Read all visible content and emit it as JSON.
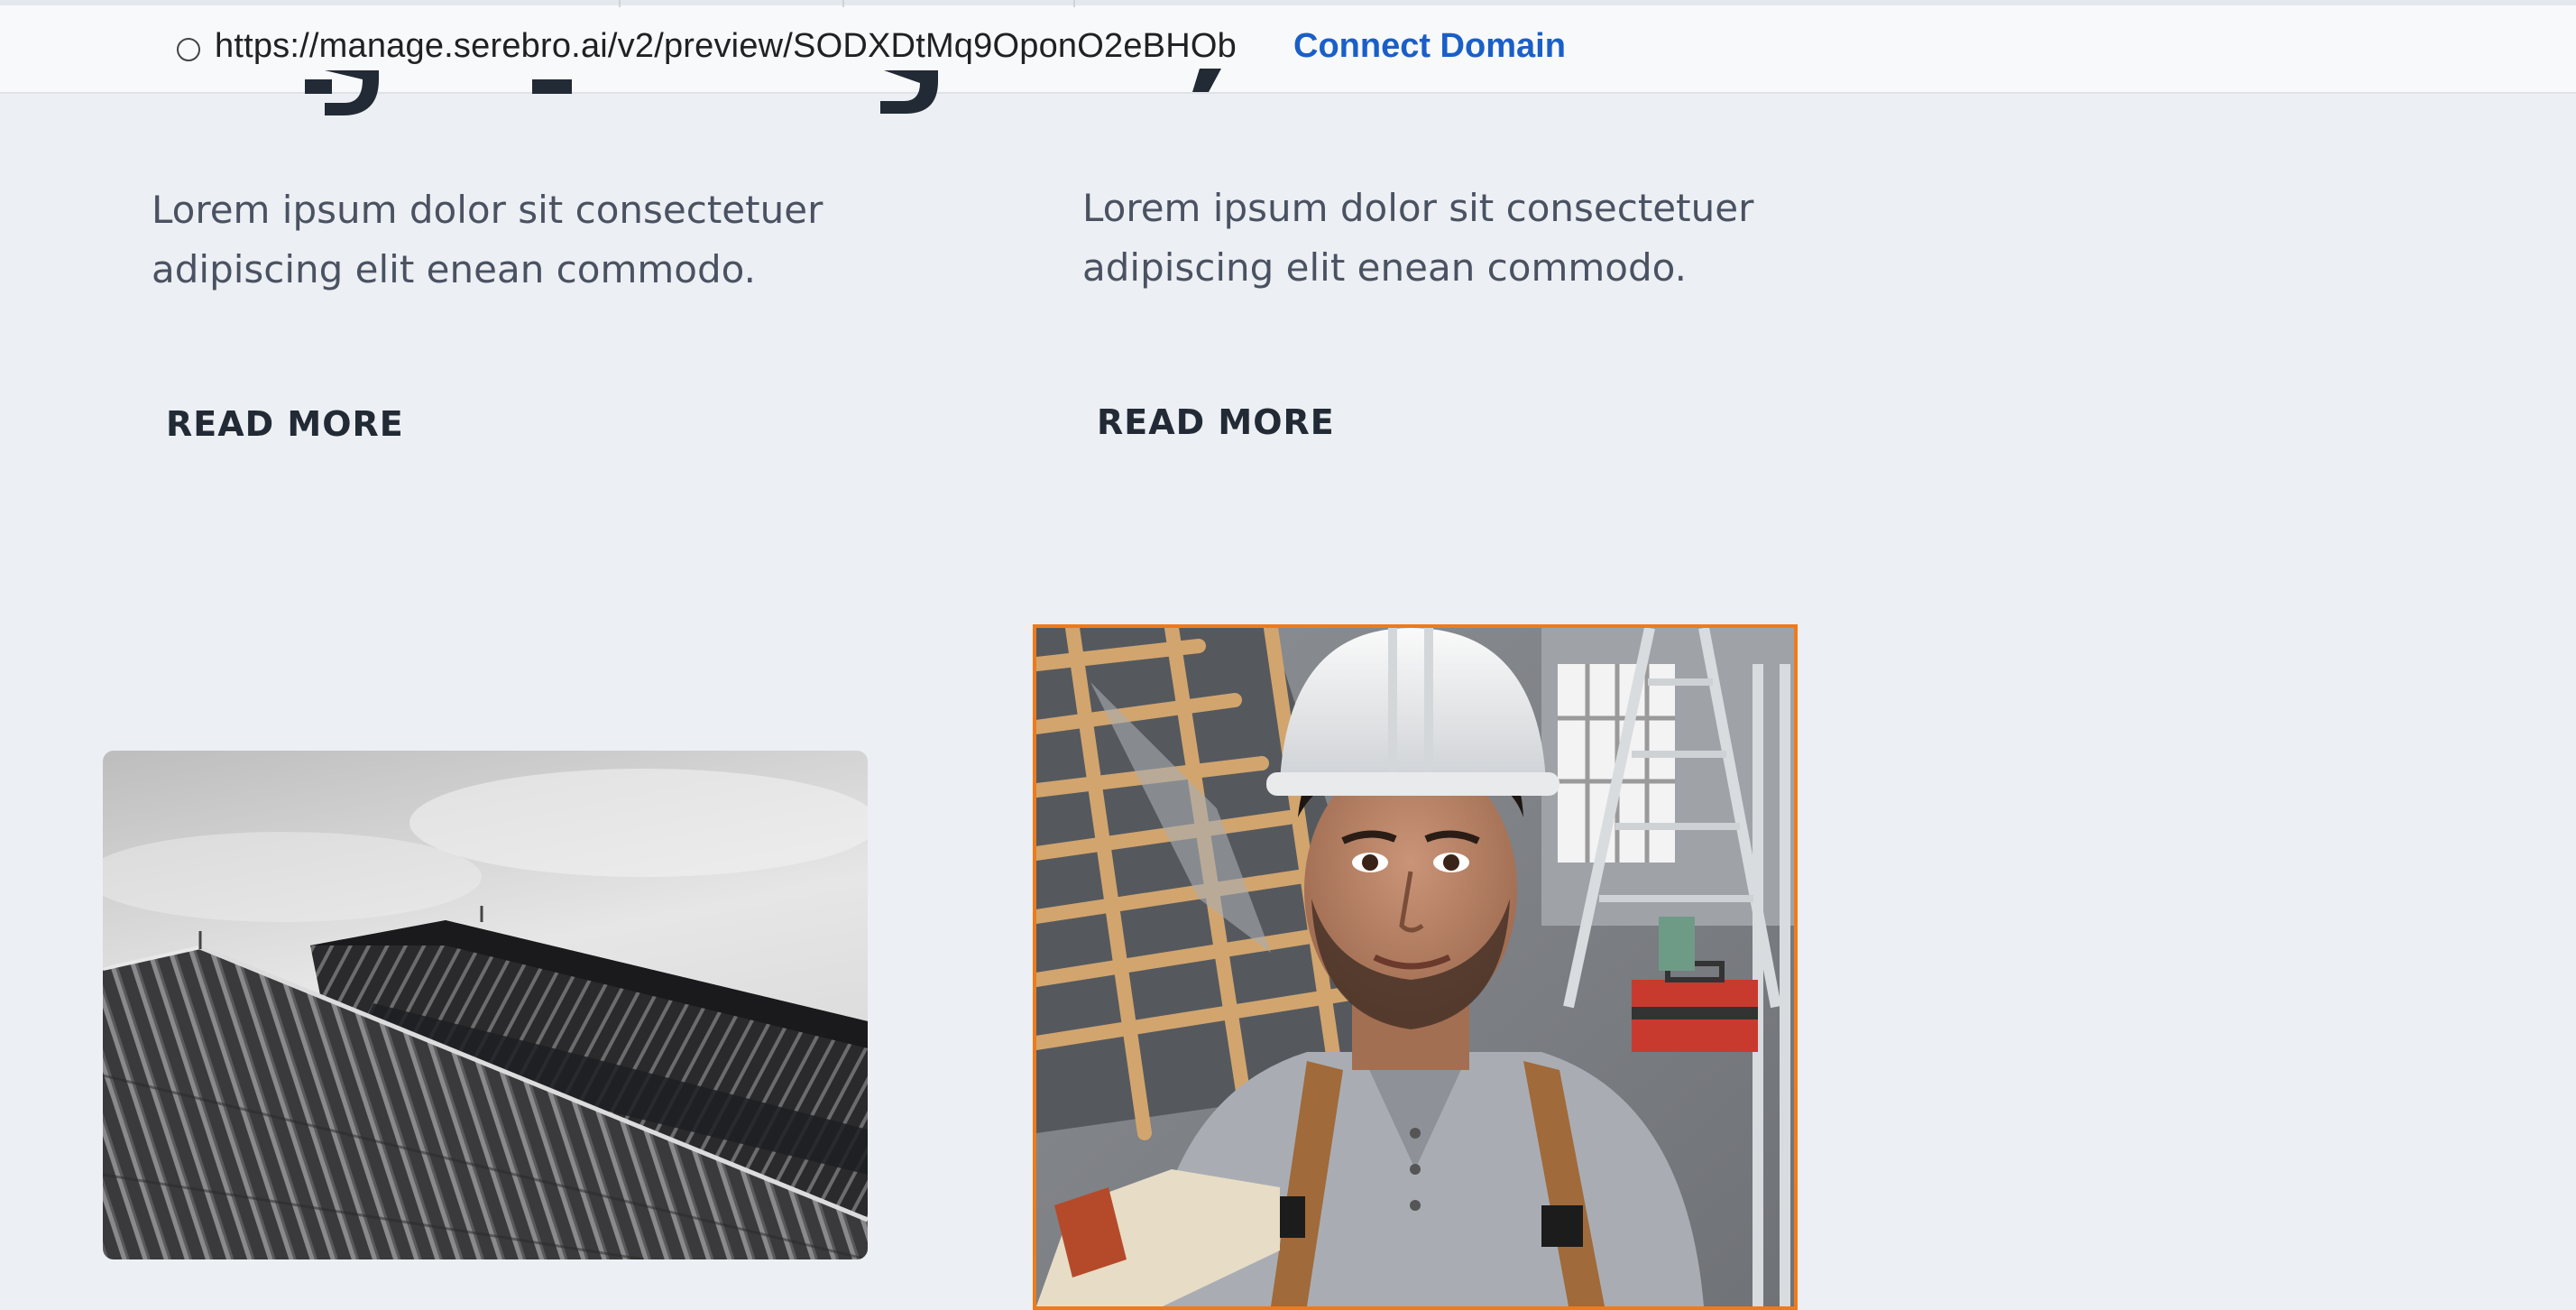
{
  "browser": {
    "url": "https://manage.serebro.ai/v2/preview/SODXDtMq9OponO2eBHOb",
    "connect_domain_label": "Connect Domain"
  },
  "cards": [
    {
      "description_lines": [
        "Lorem ipsum dolor sit consectetuer",
        "adipiscing elit enean commodo."
      ],
      "read_more_label": "READ MORE"
    },
    {
      "description_lines": [
        "Lorem ipsum dolor sit consectetuer",
        "adipiscing elit enean commodo."
      ],
      "read_more_label": "READ MORE"
    }
  ],
  "images": [
    {
      "subject": "dark metal roof under cloudy sky"
    },
    {
      "subject": "smiling roofer in white hard hat on roof"
    }
  ],
  "colors": {
    "background": "#eceff3",
    "link": "#1a5fc8",
    "selection_outline": "#f07a1a",
    "heading": "#222a35",
    "body_text": "#4a5262"
  }
}
